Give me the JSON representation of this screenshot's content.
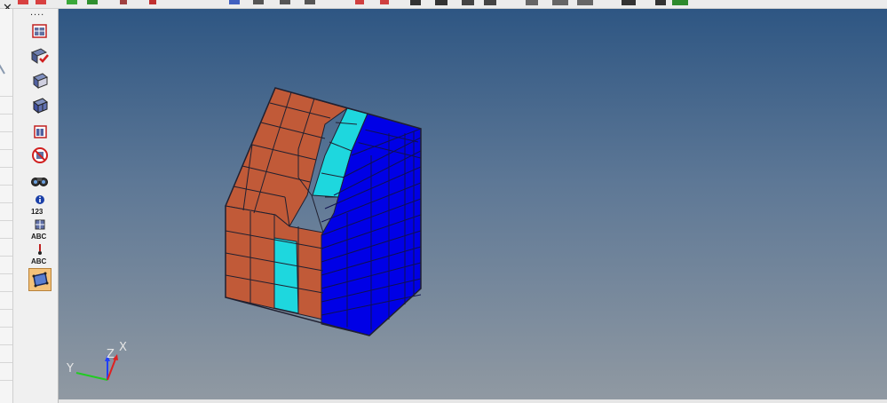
{
  "window": {
    "close_symbol": "✕"
  },
  "toolbar": {
    "icons": [
      "cut-icon",
      "copy-icon",
      "move-icon",
      "mirror-icon",
      "rotate-icon",
      "shade-icon",
      "wire-icon",
      "mesh-icon",
      "node-icon",
      "hide-icon",
      "show-icon",
      "measure-icon",
      "align-icon",
      "print-icon",
      "screenshot-icon",
      "layout-icon"
    ]
  },
  "left_panel": {
    "dots": "....",
    "tools": [
      {
        "name": "select-mode-icon"
      },
      {
        "name": "check-elements-icon"
      },
      {
        "name": "element-edit-icon"
      },
      {
        "name": "mesh-grid-icon"
      },
      {
        "name": "element-quality-icon"
      },
      {
        "name": "no-entry-icon"
      },
      {
        "name": "binoculars-icon"
      },
      {
        "name": "info-123-icon",
        "label": "123"
      },
      {
        "name": "label-abc-icon",
        "label": "ABC"
      },
      {
        "name": "pin-abc-icon",
        "label": "ABC"
      },
      {
        "name": "surface-select-icon"
      }
    ]
  },
  "triad": {
    "x_label": "X",
    "y_label": "Y",
    "z_label": "Z"
  },
  "colors": {
    "brown": "#c15a38",
    "cyan": "#1ed7de",
    "blue": "#0000e6",
    "outline": "#202030"
  }
}
